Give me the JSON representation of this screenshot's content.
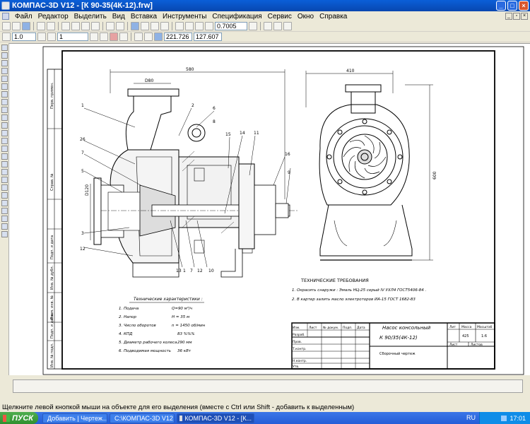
{
  "window": {
    "title": "КОМПАС-3D V12 - [К 90-35(4К-12).frw]"
  },
  "menu": {
    "items": [
      "Файл",
      "Редактор",
      "Выделить",
      "Вид",
      "Вставка",
      "Инструменты",
      "Спецификация",
      "Сервис",
      "Окно",
      "Справка"
    ]
  },
  "toolbar": {
    "zoom_value": "0.7005"
  },
  "toolbar2": {
    "line_scale": "1.0",
    "layer": "1",
    "x_coord": "221.726",
    "y_coord": "127.607"
  },
  "drawing": {
    "dims": {
      "d80": "D80",
      "d120": "D120",
      "len580": "580",
      "w410": "410",
      "h600": "600"
    },
    "labels": [
      "1",
      "2",
      "6",
      "8",
      "26",
      "7",
      "5",
      "3",
      "12",
      "15",
      "14",
      "11",
      "16",
      "9",
      "13",
      "12",
      "10",
      "1",
      "7"
    ],
    "tech_req_title": "ТЕХНИЧЕСКИЕ ТРЕБОВАНИЯ",
    "tech_req": [
      "1. Окрасить снаружи : Эмаль НЦ-25 серый IV УХЛ4 ГОСТ5406-84 .",
      "2. В картер залить масло электроторов ИА-15 ГОСТ 1682-83"
    ],
    "specs_title": "Технические характеристики :",
    "specs": [
      {
        "label": "1. Подача",
        "value": "Q=90 м³/ч"
      },
      {
        "label": "2. Напор",
        "value": "Н = 35 м"
      },
      {
        "label": "3. Число оборотов",
        "value": "n = 1450 об/мин"
      },
      {
        "label": "4. КПД",
        "value": "83 %%%"
      },
      {
        "label": "5. Диаметр рабочего колеса",
        "value": "290 мм"
      },
      {
        "label": "6. Подводимая мощность",
        "value": "36 кВт"
      }
    ],
    "side_labels": [
      "Перв. примен.",
      "Справ. №",
      "Подп. и дата",
      "Инв. № дубл.",
      "Взам. инв. №",
      "Подп. и дата",
      "Инв. № подл."
    ],
    "title_block": {
      "name": "Насос консольный",
      "code": "К 90/35(4К-12)",
      "doc_type": "Сборочный чертеж",
      "mass": "425",
      "scale": "1:6",
      "headers": {
        "lit": "Лит",
        "mass": "Масса",
        "scale": "Масштаб",
        "sheet": "Лист",
        "sheets": "Листов"
      },
      "rows": [
        "Изм.",
        "Лист",
        "№ докум.",
        "Подп.",
        "Дата",
        "Разраб.",
        "Пров.",
        "Т.контр.",
        "Н.контр.",
        "Утв."
      ]
    }
  },
  "status": {
    "text": "Щелкните левой кнопкой мыши на объекте для его выделения (вместе с Ctrl или Shift - добавить к выделенным)"
  },
  "taskbar": {
    "start": "ПУСК",
    "tasks": [
      "Добавить | Чертеж...",
      "C:\\КОМПАС-3D V12",
      "КОМПАС-3D V12 - [К..."
    ],
    "lang": "RU",
    "time": "17:01"
  },
  "colors": {
    "title_blue": "#0a5fd8",
    "taskbar_blue": "#245dd8",
    "start_green": "#2f8f2f"
  }
}
